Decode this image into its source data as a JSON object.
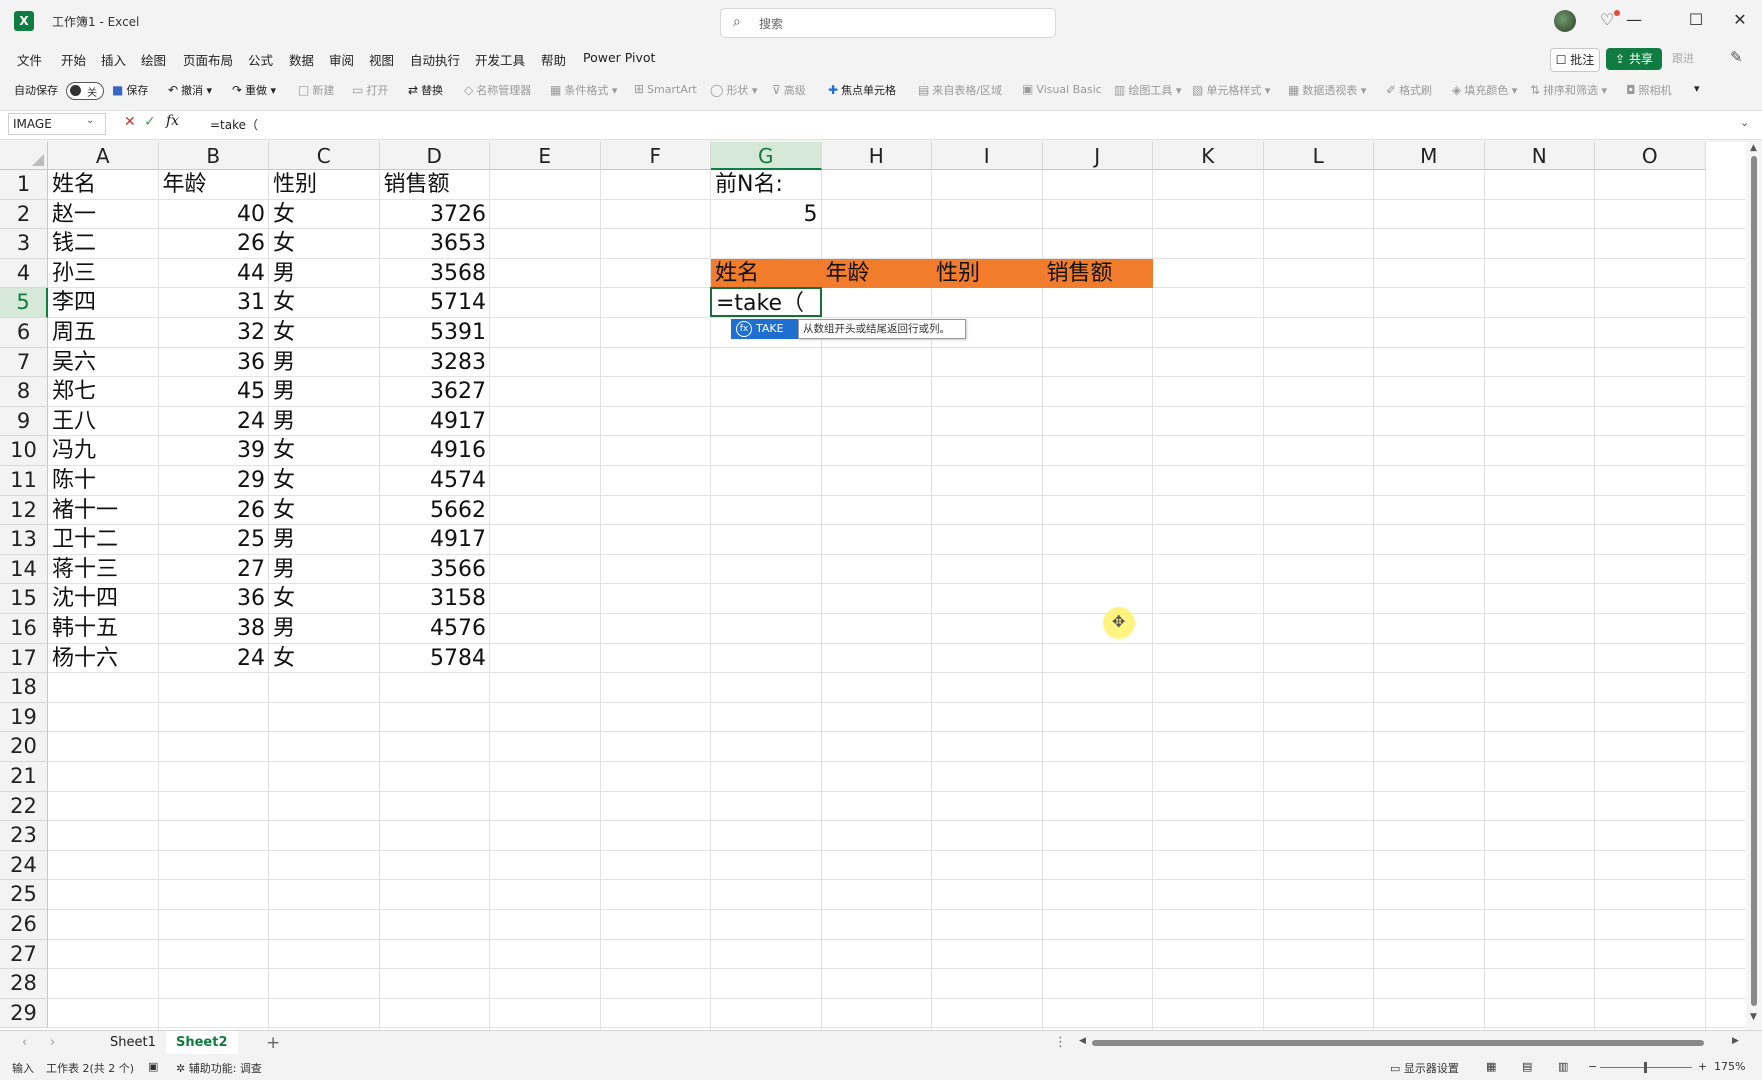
{
  "window": {
    "title": "工作簿1  -  Excel",
    "search_placeholder": "搜索",
    "icons": {
      "logo": "X",
      "search": "⌕",
      "bulb": "♡",
      "minimize": "—",
      "maximize": "☐",
      "close": "✕"
    }
  },
  "menu": {
    "items": [
      "文件",
      "开始",
      "插入",
      "绘图",
      "页面布局",
      "公式",
      "数据",
      "审阅",
      "视图",
      "自动执行",
      "开发工具",
      "帮助",
      "Power Pivot"
    ],
    "comment_label": "批注",
    "share_label": "共享",
    "follow_label": "跟进",
    "comment_icon": "☐",
    "share_icon": "⇪",
    "pane_icon": "✎"
  },
  "quick_access": {
    "autosave_label": "自动保存",
    "autosave_state": "关",
    "items": [
      {
        "label": "保存",
        "icon": "■"
      },
      {
        "label": "撤消",
        "icon": "↶"
      },
      {
        "label": "重做",
        "icon": "↷"
      },
      {
        "label": "新建",
        "icon": "□"
      },
      {
        "label": "打开",
        "icon": "▭"
      },
      {
        "label": "替换",
        "icon": "⇄"
      },
      {
        "label": "名称管理器",
        "icon": "◇"
      },
      {
        "label": "条件格式",
        "icon": "▦"
      },
      {
        "label": "SmartArt",
        "icon": "⊞"
      },
      {
        "label": "形状",
        "icon": "◯"
      },
      {
        "label": "高级",
        "icon": "⊽"
      },
      {
        "label": "焦点单元格",
        "icon": "✚"
      },
      {
        "label": "来自表格/区域",
        "icon": "▤"
      },
      {
        "label": "Visual Basic",
        "icon": "▣"
      },
      {
        "label": "绘图工具",
        "icon": "▥"
      },
      {
        "label": "单元格样式",
        "icon": "▧"
      },
      {
        "label": "数据透视表",
        "icon": "▦"
      },
      {
        "label": "格式刷",
        "icon": "✐"
      },
      {
        "label": "填充颜色",
        "icon": "◈"
      },
      {
        "label": "排序和筛选",
        "icon": "⇅"
      },
      {
        "label": "照相机",
        "icon": "◘"
      }
    ],
    "more_icon": "▾"
  },
  "formula_bar": {
    "name_box": "IMAGE",
    "cancel": "✕",
    "confirm": "✓",
    "fx": "fx",
    "formula": "=take（",
    "expand_icon": "⌄"
  },
  "grid": {
    "columns": [
      "A",
      "B",
      "C",
      "D",
      "E",
      "F",
      "G",
      "H",
      "I",
      "J",
      "K",
      "L",
      "M",
      "N",
      "O"
    ],
    "selected_column": "G",
    "rows": [
      "1",
      "2",
      "3",
      "4",
      "5",
      "6",
      "7",
      "8",
      "9",
      "10",
      "11",
      "12",
      "13",
      "14",
      "15",
      "16",
      "17",
      "18",
      "19",
      "20",
      "21",
      "22",
      "23",
      "24",
      "25",
      "26",
      "27",
      "28",
      "29"
    ],
    "selected_row": "5",
    "table_headers": [
      "姓名",
      "年龄",
      "性别",
      "销售额"
    ],
    "records": [
      [
        "赵一",
        "40",
        "女",
        "3726"
      ],
      [
        "钱二",
        "26",
        "女",
        "3653"
      ],
      [
        "孙三",
        "44",
        "男",
        "3568"
      ],
      [
        "李四",
        "31",
        "女",
        "5714"
      ],
      [
        "周五",
        "32",
        "女",
        "5391"
      ],
      [
        "吴六",
        "36",
        "男",
        "3283"
      ],
      [
        "郑七",
        "45",
        "男",
        "3627"
      ],
      [
        "王八",
        "24",
        "男",
        "4917"
      ],
      [
        "冯九",
        "39",
        "女",
        "4916"
      ],
      [
        "陈十",
        "29",
        "女",
        "4574"
      ],
      [
        "褚十一",
        "26",
        "女",
        "5662"
      ],
      [
        "卫十二",
        "25",
        "男",
        "4917"
      ],
      [
        "蒋十三",
        "27",
        "男",
        "3566"
      ],
      [
        "沈十四",
        "36",
        "女",
        "3158"
      ],
      [
        "韩十五",
        "38",
        "男",
        "4576"
      ],
      [
        "杨十六",
        "24",
        "女",
        "5784"
      ]
    ],
    "top_n_label": "前N名:",
    "top_n_value": "5",
    "result_headers": [
      "姓名",
      "年龄",
      "性别",
      "销售额"
    ],
    "active_cell_text": "=take（",
    "header_fill_color": "#f07c2c"
  },
  "autocomplete": {
    "function_name": "TAKE",
    "function_icon": "fx",
    "tooltip": "从数组开头或结尾返回行或列。"
  },
  "cursor_icon": "✥",
  "sheets": {
    "tabs": [
      "Sheet1",
      "Sheet2"
    ],
    "active": "Sheet2",
    "add_icon": "+",
    "prev_icon": "‹",
    "next_icon": "›",
    "more_icon": "⋮"
  },
  "status": {
    "mode": "输入",
    "sheet_info": "工作表 2(共 2 个)",
    "accessibility": "辅助功能: 调查",
    "display_settings": "显示器设置",
    "zoom": "175%",
    "accessibility_icon": "✲",
    "macro_icon": "▣",
    "display_icon": "▭",
    "view_icons": [
      "▦",
      "▤",
      "▥"
    ]
  }
}
